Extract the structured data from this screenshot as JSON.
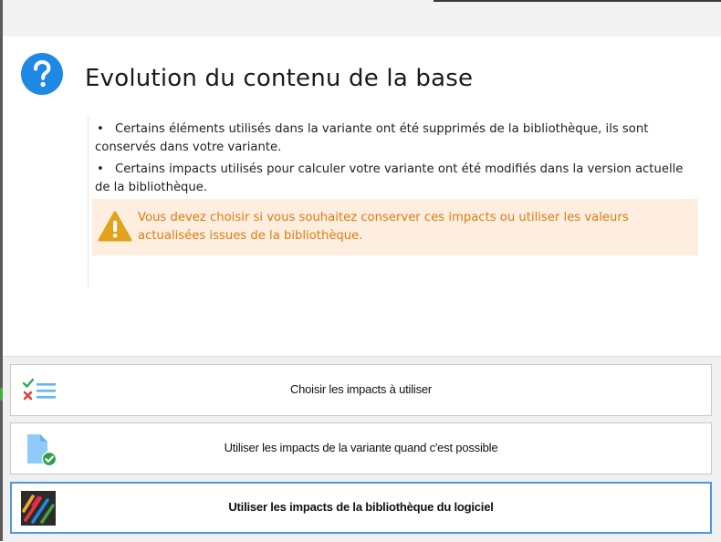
{
  "dialog": {
    "heading": "Evolution du contenu de la base",
    "bullets": [
      "Certains éléments utilisés dans la variante ont été supprimés de la bibliothèque, ils sont conservés dans votre variante.",
      "Certains impacts utilisés pour calculer votre variante ont été modifiés dans la version actuelle de la bibliothèque."
    ],
    "bullet_symbol": "•",
    "warning": "Vous devez choisir si vous souhaitez conserver ces impacts ou utiliser les valeurs actualisées issues de la bibliothèque."
  },
  "commands": [
    {
      "label": "Choisir les impacts à utiliser",
      "icon": "checklist-icon"
    },
    {
      "label": "Utiliser les impacts de la variante quand c'est possible",
      "icon": "document-check-icon"
    },
    {
      "label": "Utiliser les impacts de la bibliothèque du logiciel",
      "icon": "software-logo-icon"
    }
  ],
  "colors": {
    "help_icon": "#1e88e5",
    "warning_text": "#e07b12",
    "warning_bg": "#fdeee0",
    "focus_border": "#4a98e6"
  }
}
